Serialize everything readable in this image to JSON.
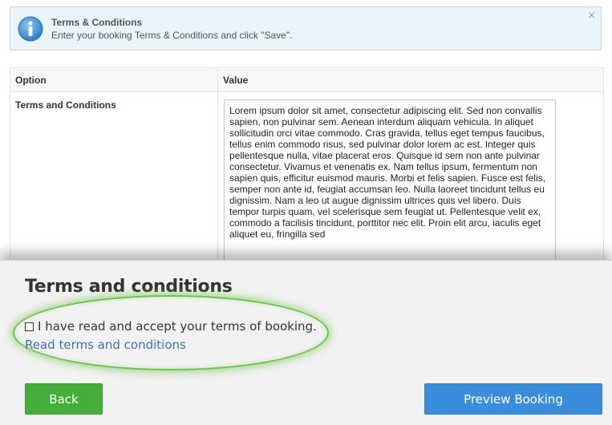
{
  "info_banner": {
    "title": "Terms & Conditions",
    "text": "Enter your booking Terms & Conditions and click \"Save\".",
    "close_glyph": "×",
    "icon": "info-icon"
  },
  "table": {
    "headers": [
      "Option",
      "Value"
    ],
    "row_label": "Terms and Conditions",
    "terms_text": "Lorem ipsum dolor sit amet, consectetur adipiscing elit. Sed non convallis sapien, non pulvinar sem. Aenean interdum aliquam vehicula. In aliquet sollicitudin orci vitae commodo. Cras gravida, tellus eget tempus faucibus, tellus enim commodo risus, sed pulvinar dolor lorem ac est. Integer quis pellentesque nulla, vitae placerat eros. Quisque id sem non ante pulvinar consectetur. Vivamus et venenatis ex. Nam tellus ipsum, fermentum non sapien quis, efficitur euismod mauris. Morbi et felis sapien. Fusce est felis, semper non ante id, feugiat accumsan leo. Nulla laoreet tincidunt tellus eu dignissim. Nam a leo ut augue dignissim ultrices quis vel libero. Duis tempor turpis quam, vel scelerisque sem feugiat ut. Pellentesque velit ex, commodo a facilisis tincidunt, porttitor nec elit. Proin elit arcu, iaculis eget aliquet eu, fringilla sed"
  },
  "panel": {
    "title": "Terms and conditions",
    "accept_label": "I have read and accept your terms of booking.",
    "accept_checked": false,
    "read_link": "Read terms and conditions",
    "back_label": "Back",
    "preview_label": "Preview Booking"
  },
  "colors": {
    "highlight": "#6cc24a",
    "back_button": "#45ad3a",
    "preview_button": "#3a8ddb",
    "link": "#3a73b5",
    "info_background": "#eaf4fb"
  }
}
